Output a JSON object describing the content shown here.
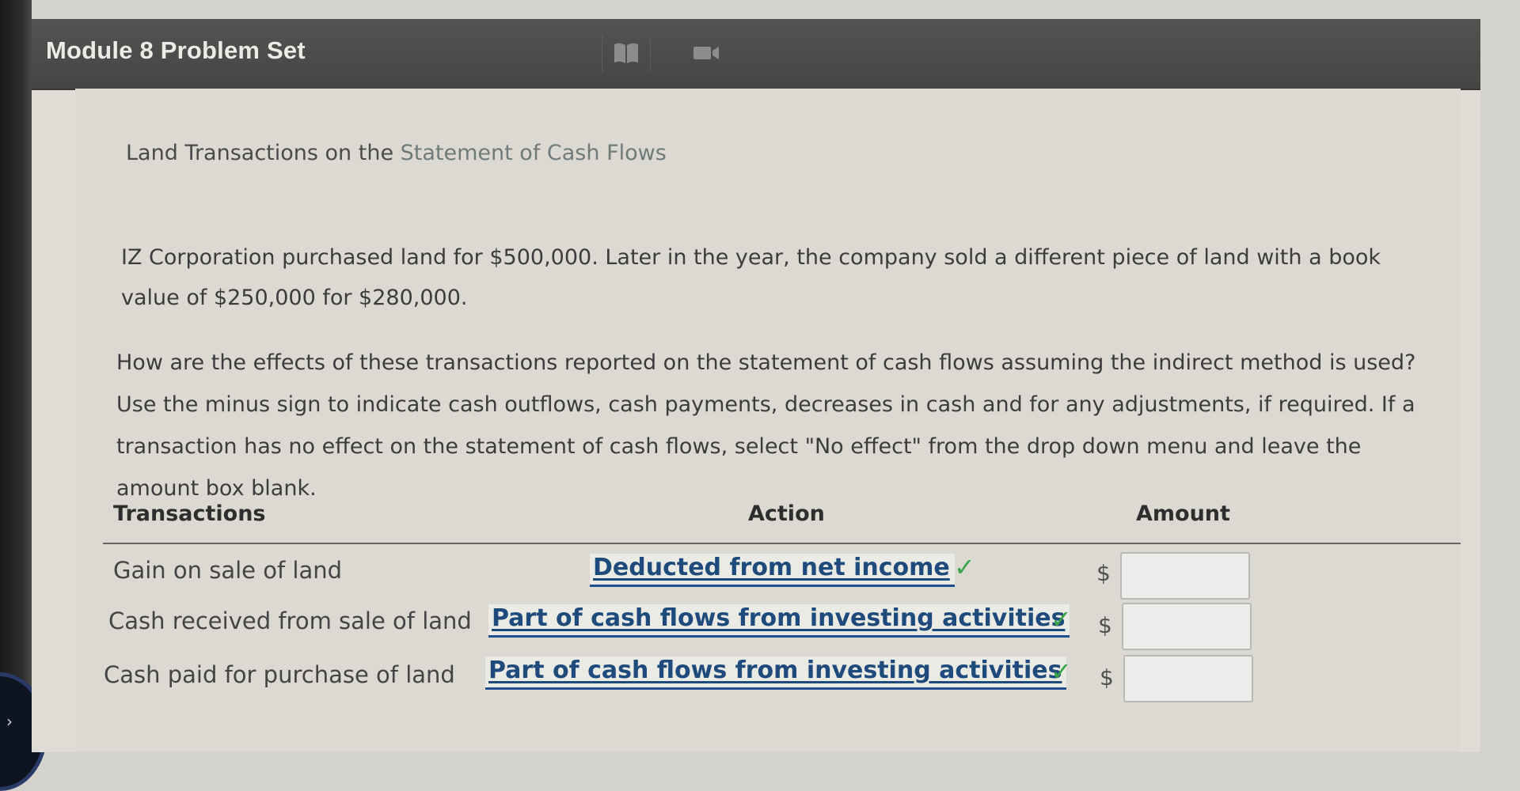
{
  "header": {
    "title": "Module 8 Problem Set",
    "icons": [
      "book-icon",
      "video-camera-icon"
    ]
  },
  "question": {
    "title_prefix": "Land Transactions on the ",
    "title_highlight": "Statement of Cash Flows",
    "paragraph1": "IZ Corporation purchased land for $500,000. Later in the year, the company sold a different piece of land with a book value of $250,000 for $280,000.",
    "paragraph2": "How are the effects of these transactions reported on the statement of cash flows assuming the indirect method is used? Use the minus sign to indicate cash outflows, cash payments, decreases in cash and for any adjustments, if required. If a transaction has no effect on the statement of cash flows, select \"No effect\" from the drop down menu and leave the amount box blank."
  },
  "table": {
    "headers": {
      "transactions": "Transactions",
      "action": "Action",
      "amount": "Amount"
    },
    "rows": [
      {
        "label": "Gain on sale of land",
        "action": "Deducted from net income",
        "check": "✓",
        "currency": "$",
        "amount": ""
      },
      {
        "label": "Cash received from sale of land",
        "action": "Part of cash flows from investing activities",
        "check": "✓",
        "currency": "$",
        "amount": ""
      },
      {
        "label": "Cash paid for purchase of land",
        "action": "Part of cash flows from investing activities",
        "check": "✓",
        "currency": "$",
        "amount": ""
      }
    ]
  },
  "colors": {
    "title_bar": "#4d4b4a",
    "select_text": "#1e4a7c",
    "check": "#3aa34a"
  }
}
